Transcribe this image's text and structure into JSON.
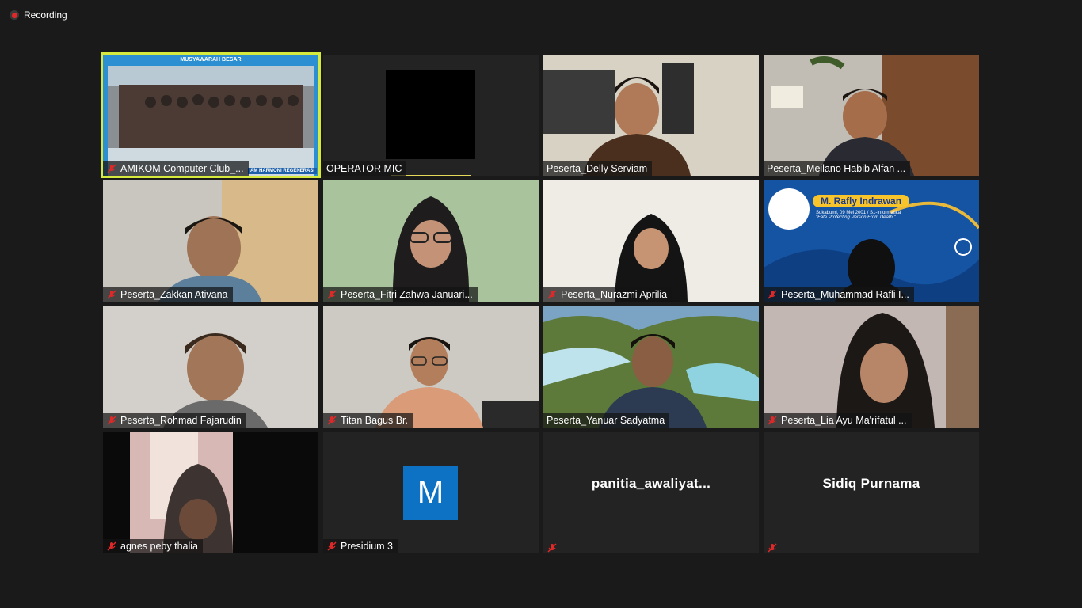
{
  "recording": {
    "label": "Recording"
  },
  "participants": [
    {
      "name": "AMIKOM Computer Club_...",
      "muted": true,
      "banner_top": "MUSYAWARAH BESAR",
      "banner_bottom": "AM HARMONI REGENERASI"
    },
    {
      "name": "OPERATOR MIC",
      "muted": false
    },
    {
      "name": "Peserta_Delly Serviam",
      "muted": false
    },
    {
      "name": "Peserta_Meilano Habib Alfan ...",
      "muted": false
    },
    {
      "name": "Peserta_Zakkan Ativana",
      "muted": true
    },
    {
      "name": "Peserta_Fitri Zahwa Januari...",
      "muted": true
    },
    {
      "name": "Peserta_Nurazmi Aprilia",
      "muted": true
    },
    {
      "name": "Peserta_Muhammad Rafli I...",
      "muted": true,
      "card_title": "M. Rafly Indrawan",
      "card_sub1": "Sukabumi, 09 Mei 2001 / S1-Informatika",
      "card_sub2": "\"Fate Protecting Person From Death.\""
    },
    {
      "name": "Peserta_Rohmad Fajarudin",
      "muted": true
    },
    {
      "name": "Titan Bagus Br.",
      "muted": true
    },
    {
      "name": "Peserta_Yanuar Sadyatma",
      "muted": false
    },
    {
      "name": "Peserta_Lia Ayu Ma'rifatul ...",
      "muted": true
    },
    {
      "name": "agnes peby thalia",
      "muted": true
    },
    {
      "name": "Presidium 3",
      "muted": true,
      "avatar_letter": "M"
    },
    {
      "name": "panitia_awaliyat...",
      "muted": true
    },
    {
      "name": "Sidiq Purnama",
      "muted": true
    }
  ],
  "colors": {
    "active_speaker": "#d6ea3d",
    "mic_muted": "#e02828",
    "avatar_blue": "#0e72c4",
    "background": "#1a1a1a"
  }
}
